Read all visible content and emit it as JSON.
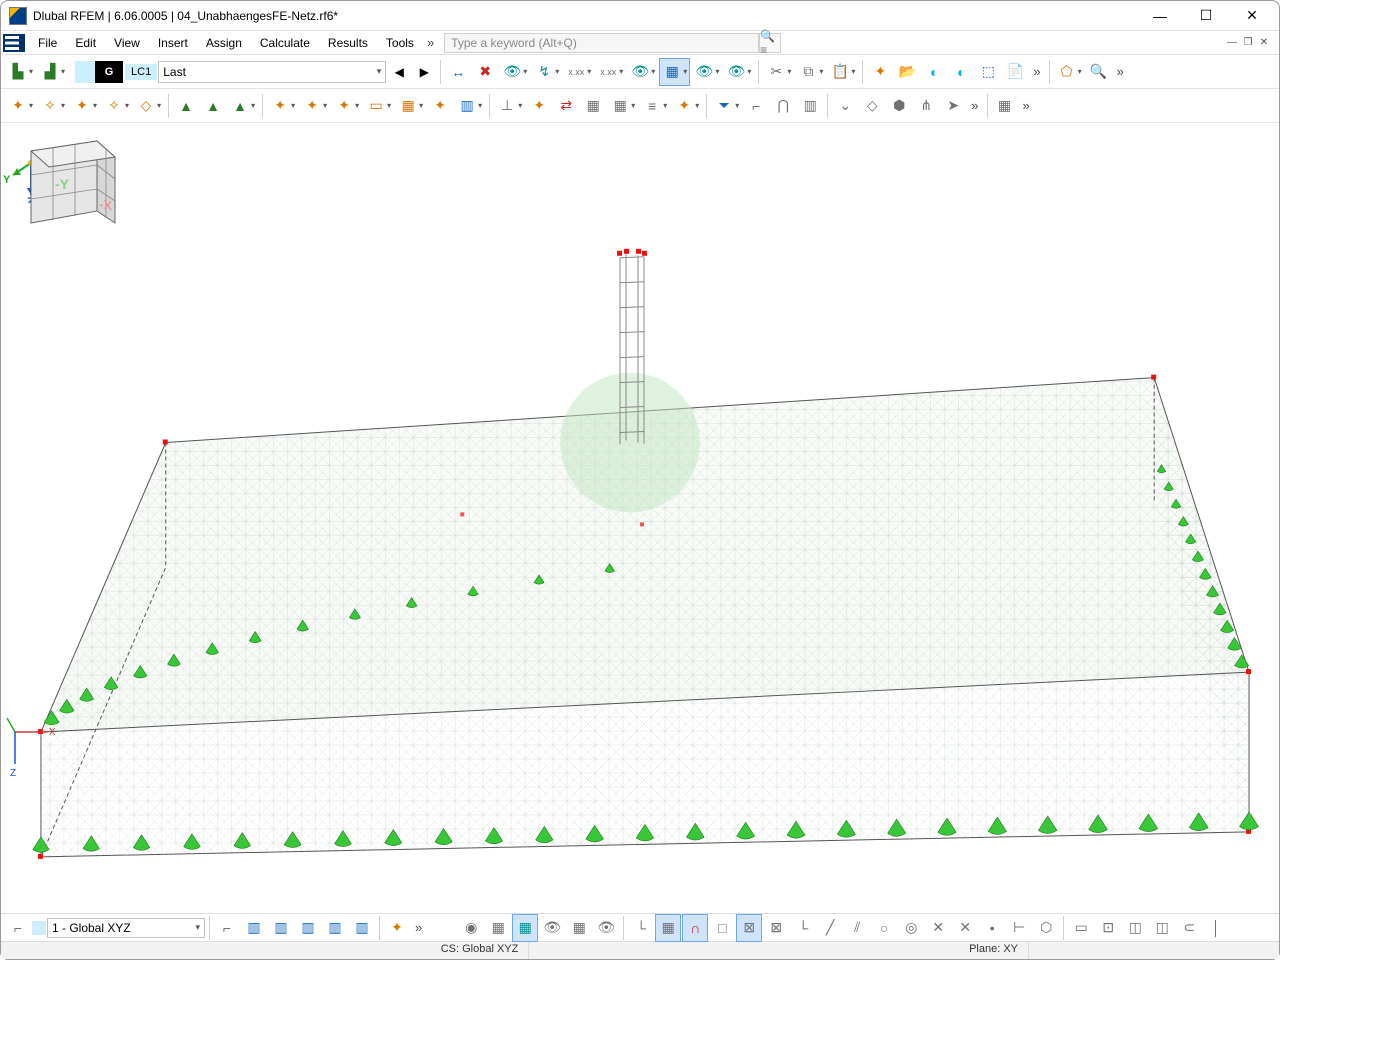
{
  "titlebar": {
    "title": "Dlubal RFEM | 6.06.0005 | 04_UnabhaengesFE-Netz.rf6*"
  },
  "menu": {
    "items": [
      "File",
      "Edit",
      "View",
      "Insert",
      "Assign",
      "Calculate",
      "Results",
      "Tools"
    ],
    "overflow_glyph": "»",
    "search_placeholder": "Type a keyword (Alt+Q)"
  },
  "toolbar1": {
    "g_label": "G",
    "lc_label": "LC1",
    "lc_select": "Last",
    "nav": {
      "prev": "◀",
      "next": "▶"
    },
    "icons": [
      {
        "name": "dim-x-icon",
        "glyph": "↔",
        "cls": "blue"
      },
      {
        "name": "dim-red-x-icon",
        "glyph": "✖",
        "cls": "red"
      },
      {
        "name": "eye-arrow-icon",
        "glyph": "👁",
        "cls": "teal",
        "dd": true
      },
      {
        "name": "deform-icon",
        "glyph": "↯",
        "cls": "teal",
        "dd": true
      },
      {
        "name": "results-xxx-icon",
        "glyph": "x.xx",
        "cls": "gray",
        "dd": true,
        "sz": "9"
      },
      {
        "name": "results-xxx2-icon",
        "glyph": "x.xx",
        "cls": "gray",
        "dd": true,
        "sz": "9"
      },
      {
        "name": "eye-toggle-icon",
        "glyph": "👁",
        "cls": "teal",
        "dd": true
      },
      {
        "name": "grid-main-icon",
        "glyph": "▦",
        "cls": "blue",
        "active": true,
        "dd": true
      },
      {
        "name": "eye-view-icon",
        "glyph": "👁",
        "cls": "teal",
        "dd": true
      },
      {
        "name": "eye-view2-icon",
        "glyph": "👁",
        "cls": "teal",
        "dd": true
      }
    ],
    "group_edit": [
      {
        "name": "cut-icon",
        "glyph": "✂",
        "cls": "gray",
        "dd": true
      },
      {
        "name": "copy-icon",
        "glyph": "⧉",
        "cls": "gray",
        "dd": true
      },
      {
        "name": "paste-icon",
        "glyph": "📋",
        "cls": "gray",
        "dd": true
      }
    ],
    "group_file": [
      {
        "name": "new-star-icon",
        "glyph": "✦",
        "cls": "org"
      },
      {
        "name": "open-folder-icon",
        "glyph": "📂",
        "cls": "org"
      },
      {
        "name": "cloud1-icon",
        "glyph": "◐",
        "cls": "cyan"
      },
      {
        "name": "cloud2-icon",
        "glyph": "◐",
        "cls": "cyan"
      },
      {
        "name": "export-icon",
        "glyph": "⬚",
        "cls": "blue"
      },
      {
        "name": "report-icon",
        "glyph": "📄",
        "cls": "org"
      }
    ],
    "group_tail": [
      {
        "name": "select-poly-icon",
        "glyph": "⬠",
        "cls": "org",
        "dd": true
      },
      {
        "name": "zoom-x-icon",
        "glyph": "🔍",
        "cls": "gray"
      }
    ]
  },
  "toolbar2": {
    "new_group": [
      {
        "name": "new-node-icon",
        "glyph": "✦",
        "cls": "org",
        "dd": true
      },
      {
        "name": "new-line-icon",
        "glyph": "✧",
        "cls": "org",
        "dd": true
      },
      {
        "name": "new-member-icon",
        "glyph": "✦",
        "cls": "org",
        "dd": true
      },
      {
        "name": "new-beam-icon",
        "glyph": "✧",
        "cls": "org",
        "dd": true
      },
      {
        "name": "new-poly-icon",
        "glyph": "◇",
        "cls": "org",
        "dd": true
      }
    ],
    "support_group": [
      {
        "name": "support1-icon",
        "glyph": "▲",
        "cls": "sup"
      },
      {
        "name": "support2-icon",
        "glyph": "▲",
        "cls": "sup"
      },
      {
        "name": "support3-icon",
        "glyph": "▲",
        "cls": "sup",
        "dd": true
      }
    ],
    "load_group": [
      {
        "name": "load-star1-icon",
        "glyph": "✦",
        "cls": "org",
        "dd": true
      },
      {
        "name": "load-star2-icon",
        "glyph": "✦",
        "cls": "org",
        "dd": true
      },
      {
        "name": "load-star3-icon",
        "glyph": "✦",
        "cls": "org",
        "dd": true
      },
      {
        "name": "load-rect-icon",
        "glyph": "▭",
        "cls": "org",
        "dd": true
      },
      {
        "name": "load-area-icon",
        "glyph": "▦",
        "cls": "org",
        "dd": true
      },
      {
        "name": "load-star4-icon",
        "glyph": "✦",
        "cls": "org"
      },
      {
        "name": "load-panel-icon",
        "glyph": "▥",
        "cls": "blue",
        "dd": true
      }
    ],
    "dim_group": [
      {
        "name": "dim1-icon",
        "glyph": "⊥",
        "cls": "gray",
        "dd": true
      },
      {
        "name": "dim-star-icon",
        "glyph": "✦",
        "cls": "org"
      },
      {
        "name": "dim-pair-icon",
        "glyph": "⇄",
        "cls": "red"
      },
      {
        "name": "dim-grid-icon",
        "glyph": "▦",
        "cls": "gray"
      },
      {
        "name": "dim-grid2-icon",
        "glyph": "▦",
        "cls": "gray",
        "dd": true
      },
      {
        "name": "dim-stack-icon",
        "glyph": "≡",
        "cls": "gray",
        "dd": true
      },
      {
        "name": "dim-star2-icon",
        "glyph": "✦",
        "cls": "org",
        "dd": true
      }
    ],
    "filter_group": [
      {
        "name": "funnel-icon",
        "glyph": "⏷",
        "cls": "blue",
        "dd": true
      },
      {
        "name": "axis-icon",
        "glyph": "⌐",
        "cls": "gray"
      },
      {
        "name": "arch-icon",
        "glyph": "⋂",
        "cls": "gray"
      },
      {
        "name": "frame-icon",
        "glyph": "▥",
        "cls": "gray"
      }
    ],
    "misc_group": [
      {
        "name": "misc1-icon",
        "glyph": "⌄",
        "cls": "gray"
      },
      {
        "name": "misc2-icon",
        "glyph": "◇",
        "cls": "gray"
      },
      {
        "name": "cube-icon",
        "glyph": "⬢",
        "cls": "gray"
      },
      {
        "name": "tree-icon",
        "glyph": "⋔",
        "cls": "gray"
      },
      {
        "name": "arrow-icon",
        "glyph": "➤",
        "cls": "gray"
      }
    ],
    "table_icon": {
      "name": "table-icon",
      "glyph": "▦",
      "cls": "gray"
    }
  },
  "bottombar": {
    "cs_select": "1 - Global XYZ",
    "left_icons": [
      {
        "name": "tool-axis-icon",
        "glyph": "⌐",
        "cls": "gray"
      },
      {
        "name": "xform1-icon",
        "glyph": "▥",
        "cls": "blue"
      },
      {
        "name": "xform2-icon",
        "glyph": "▥",
        "cls": "blue"
      },
      {
        "name": "xform3-icon",
        "glyph": "▥",
        "cls": "blue"
      },
      {
        "name": "xform4-icon",
        "glyph": "▥",
        "cls": "blue"
      },
      {
        "name": "xform5-icon",
        "glyph": "▥",
        "cls": "blue"
      }
    ],
    "mid_icons": [
      {
        "name": "mesh-star-icon",
        "glyph": "✦",
        "cls": "org"
      },
      {
        "name": "vis1-icon",
        "glyph": "◉",
        "cls": "gray"
      },
      {
        "name": "vis2-icon",
        "glyph": "▦",
        "cls": "gray"
      },
      {
        "name": "vis3-icon",
        "glyph": "▦",
        "cls": "teal",
        "active": true
      },
      {
        "name": "vis4-icon",
        "glyph": "👁",
        "cls": "gray"
      },
      {
        "name": "vis5-icon",
        "glyph": "▦",
        "cls": "gray"
      },
      {
        "name": "vis6-icon",
        "glyph": "👁",
        "cls": "gray"
      }
    ],
    "snap_icons": [
      {
        "name": "snap-origin-icon",
        "glyph": "└",
        "cls": "gray"
      },
      {
        "name": "snap-grid-icon",
        "glyph": "▦",
        "cls": "gray",
        "active": true
      },
      {
        "name": "snap-magnet-icon",
        "glyph": "∩",
        "cls": "red",
        "active": true
      },
      {
        "name": "snap-box1-icon",
        "glyph": "□",
        "cls": "gray"
      },
      {
        "name": "snap-box2-icon",
        "glyph": "⊠",
        "cls": "gray",
        "active": true
      },
      {
        "name": "snap-box3-icon",
        "glyph": "⊠",
        "cls": "gray"
      },
      {
        "name": "snap-angle-icon",
        "glyph": "└",
        "cls": "gray"
      },
      {
        "name": "snap-line1-icon",
        "glyph": "╱",
        "cls": "gray"
      },
      {
        "name": "snap-line2-icon",
        "glyph": "⫽",
        "cls": "gray"
      },
      {
        "name": "snap-circle1-icon",
        "glyph": "○",
        "cls": "gray"
      },
      {
        "name": "snap-circle2-icon",
        "glyph": "◎",
        "cls": "gray"
      },
      {
        "name": "snap-x1-icon",
        "glyph": "✕",
        "cls": "gray"
      },
      {
        "name": "snap-x2-icon",
        "glyph": "✕",
        "cls": "gray"
      },
      {
        "name": "snap-dot-icon",
        "glyph": "•",
        "cls": "gray"
      },
      {
        "name": "snap-tick-icon",
        "glyph": "⊢",
        "cls": "gray"
      },
      {
        "name": "snap-hex-icon",
        "glyph": "⬡",
        "cls": "gray"
      }
    ],
    "tail_icons": [
      {
        "name": "tail1-icon",
        "glyph": "▭",
        "cls": "gray"
      },
      {
        "name": "tail2-icon",
        "glyph": "⊡",
        "cls": "gray"
      },
      {
        "name": "tail3-icon",
        "glyph": "◫",
        "cls": "gray"
      },
      {
        "name": "tail4-icon",
        "glyph": "◫",
        "cls": "gray"
      },
      {
        "name": "tail5-icon",
        "glyph": "⊂",
        "cls": "gray"
      },
      {
        "name": "tail6-icon",
        "glyph": "│",
        "cls": "gray"
      }
    ]
  },
  "statusbar": {
    "cs": "CS: Global XYZ",
    "plane": "Plane: XY"
  },
  "axes": {
    "x": "X",
    "y": "Y",
    "z": "Z"
  },
  "navcube": {
    "x": "-X",
    "y": "-Y"
  }
}
